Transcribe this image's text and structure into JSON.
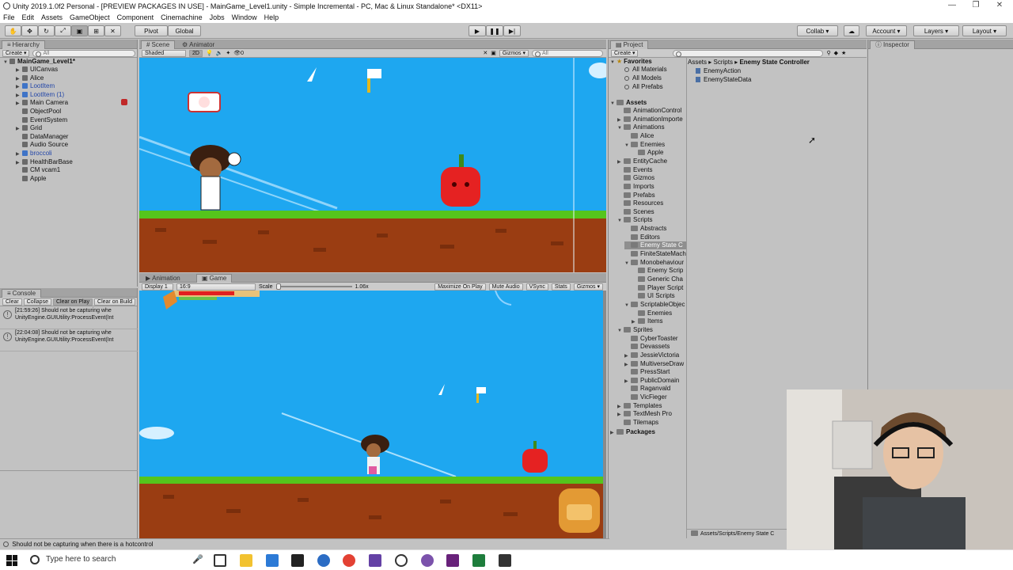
{
  "window": {
    "title": "Unity 2019.1.0f2 Personal - [PREVIEW PACKAGES IN USE] - MainGame_Level1.unity - Simple Incremental - PC, Mac & Linux Standalone* <DX11>",
    "minimize": "—",
    "maximize": "❐",
    "close": "✕"
  },
  "menu": [
    "File",
    "Edit",
    "Assets",
    "GameObject",
    "Component",
    "Cinemachine",
    "Jobs",
    "Window",
    "Help"
  ],
  "toolbar": {
    "pivot": "Pivot",
    "global": "Global",
    "collab": "Collab ▾",
    "account": "Account",
    "layers": "Layers",
    "layout": "Layout"
  },
  "hierarchy": {
    "tab": "Hierarchy",
    "create": "Create ▾",
    "search": "All",
    "scene": "MainGame_Level1*",
    "items": [
      {
        "label": "UICanvas",
        "indent": 2,
        "arrow": "▶",
        "blue": false
      },
      {
        "label": "Alice",
        "indent": 2,
        "arrow": "▶",
        "blue": false
      },
      {
        "label": "LootItem",
        "indent": 2,
        "arrow": "▶",
        "blue": true
      },
      {
        "label": "LootItem (1)",
        "indent": 2,
        "arrow": "▶",
        "blue": true
      },
      {
        "label": "Main Camera",
        "indent": 2,
        "arrow": "▶",
        "blue": false
      },
      {
        "label": "ObjectPool",
        "indent": 2,
        "arrow": "",
        "blue": false
      },
      {
        "label": "EventSystem",
        "indent": 2,
        "arrow": "",
        "blue": false
      },
      {
        "label": "Grid",
        "indent": 2,
        "arrow": "▶",
        "blue": false
      },
      {
        "label": "DataManager",
        "indent": 2,
        "arrow": "",
        "blue": false
      },
      {
        "label": "Audio Source",
        "indent": 2,
        "arrow": "",
        "blue": false
      },
      {
        "label": "broccoli",
        "indent": 2,
        "arrow": "▶",
        "blue": true
      },
      {
        "label": "HealthBarBase",
        "indent": 2,
        "arrow": "▶",
        "blue": false
      },
      {
        "label": "CM vcam1",
        "indent": 2,
        "arrow": "",
        "blue": false
      },
      {
        "label": "Apple",
        "indent": 2,
        "arrow": "",
        "blue": false
      }
    ]
  },
  "scene": {
    "tabs": [
      "Scene",
      "Animator"
    ],
    "shading": "Shaded",
    "mode2d": "2D",
    "gizmos": "Gizmos ▾",
    "search": "All"
  },
  "game": {
    "tabs": [
      "Animation",
      "Game"
    ],
    "display": "Display 1",
    "aspect": "16:9",
    "scale_label": "Scale",
    "scale_value": "1.06x",
    "maximize": "Maximize On Play",
    "mute": "Mute Audio",
    "vsync": "VSync",
    "stats": "Stats",
    "gizmos": "Gizmos ▾"
  },
  "console": {
    "tab": "Console",
    "buttons": [
      "Clear",
      "Collapse",
      "Clear on Play",
      "Clear on Build"
    ],
    "entries": [
      {
        "line1": "[21:59:26] Should not be capturing whe",
        "line2": "UnityEngine.GUIUtility:ProcessEvent(Int"
      },
      {
        "line1": "[22:04:08] Should not be capturing whe",
        "line2": "UnityEngine.GUIUtility:ProcessEvent(Int"
      }
    ]
  },
  "status_bar": "Should not be capturing when there is a hotcontrol",
  "project": {
    "tab": "Project",
    "create": "Create ▾",
    "breadcrumb": [
      "Assets",
      "Scripts",
      "Enemy State Controller"
    ],
    "favorites_label": "Favorites",
    "favorites": [
      "All Materials",
      "All Models",
      "All Prefabs"
    ],
    "assets_label": "Assets",
    "tree": [
      {
        "label": "AnimationControl",
        "indent": 1,
        "arrow": ""
      },
      {
        "label": "AnimationImporte",
        "indent": 1,
        "arrow": "▶"
      },
      {
        "label": "Animations",
        "indent": 1,
        "arrow": "▼"
      },
      {
        "label": "Alice",
        "indent": 2,
        "arrow": ""
      },
      {
        "label": "Enemies",
        "indent": 2,
        "arrow": "▼"
      },
      {
        "label": "Apple",
        "indent": 3,
        "arrow": ""
      },
      {
        "label": "EntityCache",
        "indent": 1,
        "arrow": "▶"
      },
      {
        "label": "Events",
        "indent": 1,
        "arrow": ""
      },
      {
        "label": "Gizmos",
        "indent": 1,
        "arrow": ""
      },
      {
        "label": "Imports",
        "indent": 1,
        "arrow": ""
      },
      {
        "label": "Prefabs",
        "indent": 1,
        "arrow": ""
      },
      {
        "label": "Resources",
        "indent": 1,
        "arrow": ""
      },
      {
        "label": "Scenes",
        "indent": 1,
        "arrow": ""
      },
      {
        "label": "Scripts",
        "indent": 1,
        "arrow": "▼"
      },
      {
        "label": "Abstracts",
        "indent": 2,
        "arrow": ""
      },
      {
        "label": "Editors",
        "indent": 2,
        "arrow": ""
      },
      {
        "label": "Enemy State C",
        "indent": 2,
        "arrow": "",
        "selected": true
      },
      {
        "label": "FiniteStateMach",
        "indent": 2,
        "arrow": ""
      },
      {
        "label": "Monobehaviour",
        "indent": 2,
        "arrow": "▼"
      },
      {
        "label": "Enemy Scrip",
        "indent": 3,
        "arrow": ""
      },
      {
        "label": "Generic Cha",
        "indent": 3,
        "arrow": ""
      },
      {
        "label": "Player Script",
        "indent": 3,
        "arrow": ""
      },
      {
        "label": "UI Scripts",
        "indent": 3,
        "arrow": ""
      },
      {
        "label": "ScriptableObjec",
        "indent": 2,
        "arrow": "▼"
      },
      {
        "label": "Enemies",
        "indent": 3,
        "arrow": ""
      },
      {
        "label": "Items",
        "indent": 3,
        "arrow": "▶"
      },
      {
        "label": "Sprites",
        "indent": 1,
        "arrow": "▼"
      },
      {
        "label": "CyberToaster",
        "indent": 2,
        "arrow": ""
      },
      {
        "label": "Devassets",
        "indent": 2,
        "arrow": ""
      },
      {
        "label": "JessieVictoria",
        "indent": 2,
        "arrow": "▶"
      },
      {
        "label": "MultiverseDraw",
        "indent": 2,
        "arrow": "▶"
      },
      {
        "label": "PressStart",
        "indent": 2,
        "arrow": ""
      },
      {
        "label": "PublicDomain",
        "indent": 2,
        "arrow": "▶"
      },
      {
        "label": "Raganvald",
        "indent": 2,
        "arrow": ""
      },
      {
        "label": "VicFieger",
        "indent": 2,
        "arrow": ""
      },
      {
        "label": "Templates",
        "indent": 1,
        "arrow": "▶"
      },
      {
        "label": "TextMesh Pro",
        "indent": 1,
        "arrow": "▶"
      },
      {
        "label": "Tilemaps",
        "indent": 1,
        "arrow": ""
      }
    ],
    "packages_label": "Packages",
    "files": [
      "EnemyAction",
      "EnemyStateData"
    ],
    "footer_path": "Assets/Scripts/Enemy State C"
  },
  "inspector": {
    "tab": "Inspector"
  },
  "taskbar": {
    "search_placeholder": "Type here to search"
  },
  "colors": {
    "sky": "#1ea7f0",
    "grass": "#55c51c",
    "dirt": "#9a3d12",
    "selection": "#8f8f8f"
  }
}
